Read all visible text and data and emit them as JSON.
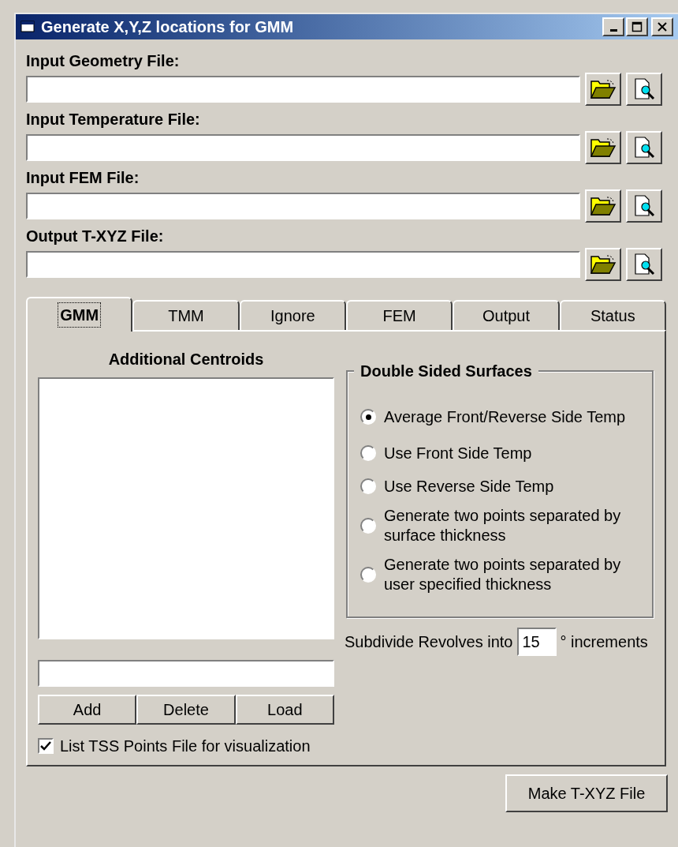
{
  "window": {
    "title": "Generate X,Y,Z locations for GMM"
  },
  "file_fields": [
    {
      "label": "Input Geometry File:"
    },
    {
      "label": "Input Temperature File:"
    },
    {
      "label": "Input FEM File:"
    },
    {
      "label": "Output T-XYZ File:"
    }
  ],
  "tabs": [
    {
      "label": "GMM",
      "selected": true
    },
    {
      "label": "TMM",
      "selected": false
    },
    {
      "label": "Ignore",
      "selected": false
    },
    {
      "label": "FEM",
      "selected": false
    },
    {
      "label": "Output",
      "selected": false
    },
    {
      "label": "Status",
      "selected": false
    }
  ],
  "gmm_panel": {
    "centroids_heading": "Additional Centroids",
    "centroid_buttons": [
      "Add",
      "Delete",
      "Load"
    ],
    "list_tss": {
      "label": "List TSS Points File for visualization",
      "checked": true
    },
    "double_sided": {
      "title": "Double Sided Surfaces",
      "options": [
        {
          "label": "Average Front/Reverse Side Temp",
          "selected": true
        },
        {
          "label": "Use Front Side Temp",
          "selected": false
        },
        {
          "label": "Use Reverse Side Temp",
          "selected": false
        },
        {
          "label": "Generate two points separated by surface thickness",
          "selected": false
        },
        {
          "label": "Generate two points separated by user specified thickness",
          "selected": false
        }
      ]
    },
    "subdivide": {
      "before": "Subdivide Revolves into",
      "value": "15",
      "after": "° increments"
    }
  },
  "make_button": "Make T-XYZ File"
}
